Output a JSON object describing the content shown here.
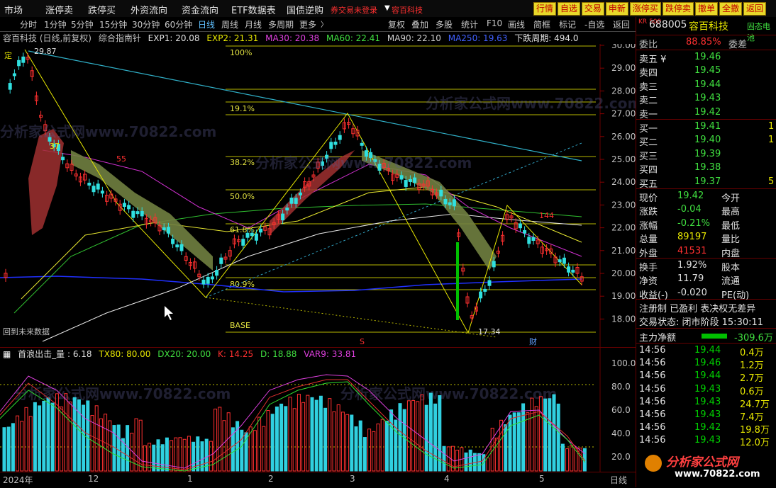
{
  "menu": [
    "市场",
    "涨停卖",
    "跌停买",
    "外资流向",
    "资金流向",
    "ETF数据表",
    "国债逆购"
  ],
  "menu_alert": "券交易未登录",
  "menu_stock": "容百科技",
  "right_buttons": [
    "行情",
    "自选",
    "交易",
    "申新",
    "涨停买",
    "跌停卖",
    "撤单",
    "全撤",
    "返回"
  ],
  "toolbar_left": [
    "分时",
    "1分钟",
    "5分钟",
    "15分钟",
    "30分钟",
    "60分钟",
    "日线",
    "周线",
    "月线",
    "多周期",
    "更多"
  ],
  "toolbar_right": [
    "复权",
    "叠加",
    "多股",
    "统计",
    "F10",
    "画线",
    "简框",
    "标记",
    "-自选",
    "返回"
  ],
  "infobar": {
    "title": "容百科技 (日线,前复权)",
    "indicator": "综合指南针",
    "exp1": "EXP1: 20.08",
    "exp2": "EXP2: 21.31",
    "ma30": "MA30: 20.38",
    "ma60": "MA60: 22.41",
    "ma90": "MA90: 22.10",
    "ma250": "MA250: 19.63",
    "period": "下跌周期: 494.0"
  },
  "fib_labels": [
    "100%",
    "19.1%",
    "38.2%",
    "50.0%",
    "61.8%",
    "80.9%",
    "BASE"
  ],
  "price_labels": {
    "high": "29.87",
    "low": "17.34",
    "mark37": "37",
    "mark55": "55",
    "mark144": "144",
    "ding": "定"
  },
  "y_axis_main": [
    "30.00",
    "29.00",
    "28.00",
    "27.00",
    "26.00",
    "25.00",
    "24.00",
    "23.00",
    "22.00",
    "21.00",
    "20.00",
    "19.00",
    "18.00"
  ],
  "y_axis_sub": [
    "100.0",
    "80.0",
    "60.0",
    "40.0",
    "20.0"
  ],
  "bottom_note": "回到未来数据",
  "fin_mark": "财",
  "s_mark": "S",
  "subinfo": {
    "name": "首浪出击_量 : 6.18",
    "tx80": "TX80: 80.00",
    "dx20": "DX20: 20.00",
    "k": "K: 14.25",
    "d": "D: 18.88",
    "var9": "VAR9: 33.81"
  },
  "x_axis": [
    "2024年",
    "12",
    "1",
    "2",
    "3",
    "4",
    "5"
  ],
  "x_right": "日线",
  "watermark": "分析家公式网www.70822.com",
  "panel": {
    "logo": "KR 500",
    "code": "688005",
    "name": "容百科技",
    "tag": "固态电池",
    "weibi_label": "委比",
    "weibi": "88.85%",
    "weicha_label": "委差",
    "sell": [
      {
        "label": "卖五 ¥",
        "price": "19.46",
        "vol": ""
      },
      {
        "label": "卖四",
        "price": "19.45",
        "vol": ""
      },
      {
        "label": "卖三",
        "price": "19.44",
        "vol": ""
      },
      {
        "label": "卖二",
        "price": "19.43",
        "vol": ""
      },
      {
        "label": "卖一",
        "price": "19.42",
        "vol": ""
      }
    ],
    "buy": [
      {
        "label": "买一",
        "price": "19.41",
        "vol": "1"
      },
      {
        "label": "买二",
        "price": "19.40",
        "vol": "1"
      },
      {
        "label": "买三",
        "price": "19.39",
        "vol": ""
      },
      {
        "label": "买四",
        "price": "19.38",
        "vol": ""
      },
      {
        "label": "买五",
        "price": "19.37",
        "vol": "5"
      }
    ],
    "stats": [
      {
        "l1": "现价",
        "v1": "19.42",
        "l2": "今开"
      },
      {
        "l1": "涨跌",
        "v1": "-0.04",
        "l2": "最高"
      },
      {
        "l1": "涨幅",
        "v1": "-0.21%",
        "l2": "最低"
      },
      {
        "l1": "总量",
        "v1": "89197",
        "l2": "量比"
      },
      {
        "l1": "外盘",
        "v1": "41531",
        "l2": "内盘"
      }
    ],
    "stats2": [
      {
        "l1": "换手",
        "v1": "1.92%",
        "l2": "股本"
      },
      {
        "l1": "净资",
        "v1": "11.79",
        "l2": "流通"
      },
      {
        "l1": "收益(-)",
        "v1": "-0.020",
        "l2": "PE(动)"
      }
    ],
    "flags": "注册制 已盈利 表决权无差异",
    "status": "交易状态: 闭市阶段 15:30:11",
    "flow_label": "主力净额",
    "flow_value": "-309.6万",
    "ticks": [
      {
        "t": "14:56",
        "p": "19.44",
        "v": "0.4万",
        "c": "#00d000"
      },
      {
        "t": "14:56",
        "p": "19.46",
        "v": "1.2万",
        "c": "#00d000"
      },
      {
        "t": "14:56",
        "p": "19.44",
        "v": "2.7万",
        "c": "#00d000"
      },
      {
        "t": "14:56",
        "p": "19.43",
        "v": "0.6万",
        "c": "#00d000"
      },
      {
        "t": "14:56",
        "p": "19.43",
        "v": "24.7万",
        "c": "#00d000"
      },
      {
        "t": "14:56",
        "p": "19.43",
        "v": "7.4万",
        "c": "#00d000"
      },
      {
        "t": "14:56",
        "p": "19.42",
        "v": "19.8万",
        "c": "#00d000"
      },
      {
        "t": "14:56",
        "p": "19.43",
        "v": "12.0万",
        "c": "#00d000"
      }
    ],
    "brand": "分析家公式网",
    "brand_url": "www.70822.com"
  }
}
